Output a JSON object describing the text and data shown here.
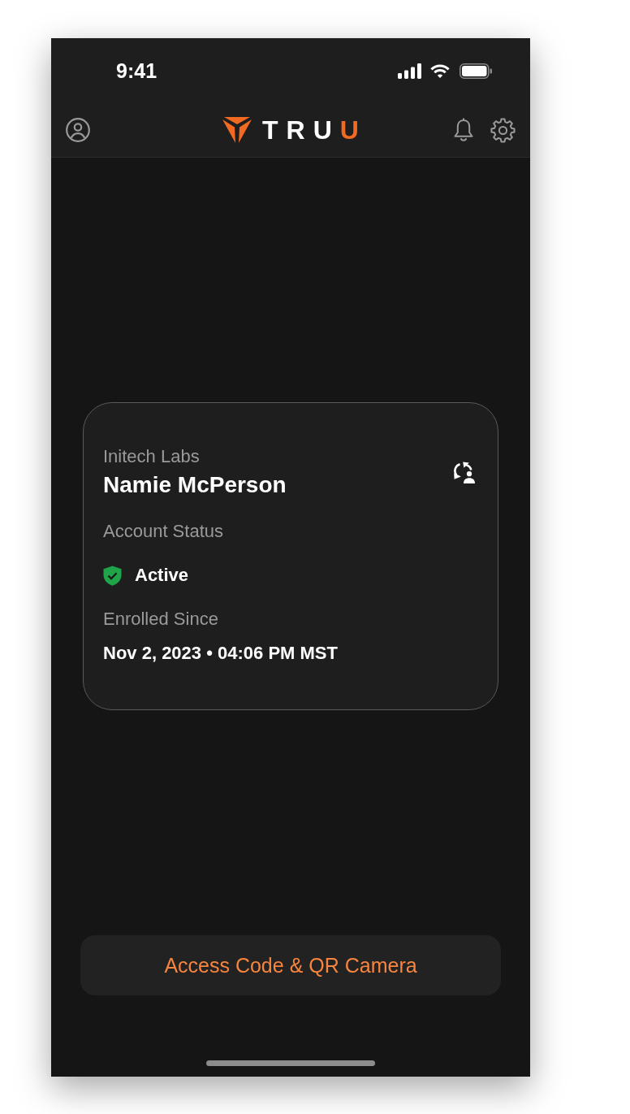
{
  "status_bar": {
    "time": "9:41"
  },
  "header": {
    "logo": {
      "wordmark": "TRU",
      "wordmark_accent": "U"
    }
  },
  "account_card": {
    "organization": "Initech Labs",
    "name": "Namie McPerson",
    "account_status": {
      "label": "Account Status",
      "value": "Active"
    },
    "enrolled_since": {
      "label": "Enrolled Since",
      "value": "Nov 2, 2023 • 04:06 PM MST"
    }
  },
  "primary_button": {
    "label": "Access Code & QR Camera"
  }
}
